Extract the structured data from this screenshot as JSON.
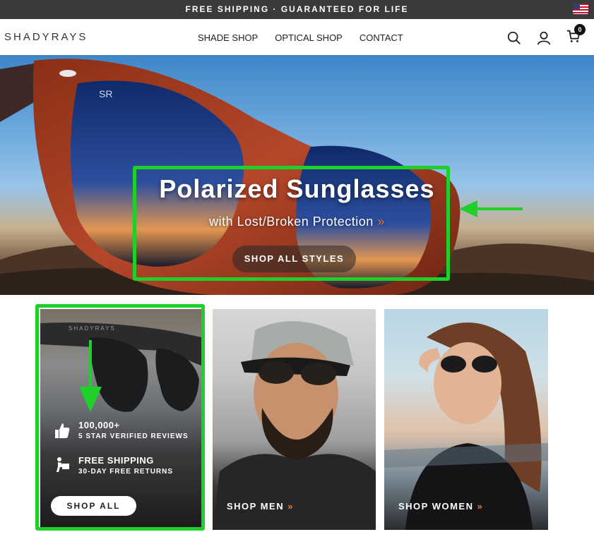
{
  "topbar": {
    "text": "FREE SHIPPING · GUARANTEED FOR LIFE",
    "flag_icon": "us-flag-icon"
  },
  "header": {
    "logo": "SHADYRAYS",
    "nav": [
      {
        "label": "SHADE SHOP"
      },
      {
        "label": "OPTICAL SHOP"
      },
      {
        "label": "CONTACT"
      }
    ],
    "icons": [
      "search-icon",
      "account-icon",
      "cart-icon"
    ],
    "cart_count": "0"
  },
  "hero": {
    "title": "Polarized Sunglasses",
    "subtitle": "with Lost/Broken Protection",
    "subtitle_chevron": "»",
    "button": "SHOP ALL STYLES",
    "lens_mark": "SR"
  },
  "cards": {
    "promo": {
      "feature1_title": "100,000+",
      "feature1_sub": "5 STAR VERIFIED REVIEWS",
      "feature2_title": "FREE SHIPPING",
      "feature2_sub": "30-DAY FREE RETURNS",
      "button": "SHOP ALL"
    },
    "men": {
      "label": "SHOP MEN",
      "chevron": "»"
    },
    "women": {
      "label": "SHOP WOMEN",
      "chevron": "»"
    }
  },
  "colors": {
    "callout": "#1fcf2a",
    "accent": "#e07a3a",
    "topbar": "#3a3a3a"
  }
}
